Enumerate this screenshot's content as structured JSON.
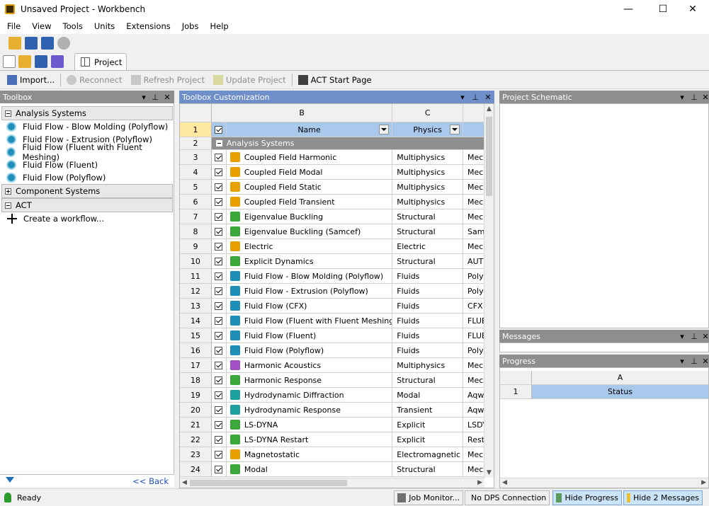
{
  "window": {
    "title": "Unsaved Project - Workbench",
    "min": "—",
    "max": "☐",
    "close": "✕"
  },
  "menu": [
    "File",
    "View",
    "Tools",
    "Units",
    "Extensions",
    "Jobs",
    "Help"
  ],
  "tab": {
    "label": "Project"
  },
  "toolbar": {
    "import": "Import...",
    "reconnect": "Reconnect",
    "refresh": "Refresh Project",
    "update": "Update Project",
    "act_start": "ACT Start Page"
  },
  "toolbox": {
    "title": "Toolbox",
    "groups": [
      {
        "label": "Analysis Systems",
        "items": [
          "Fluid Flow - Blow Molding (Polyflow)",
          "Fluid Flow - Extrusion (Polyflow)",
          "Fluid Flow (Fluent with Fluent Meshing)",
          "Fluid Flow (Fluent)",
          "Fluid Flow (Polyflow)"
        ]
      },
      {
        "label": "Component Systems"
      },
      {
        "label": "ACT",
        "items": [
          "Create a workflow..."
        ]
      }
    ],
    "back": "<< Back"
  },
  "customization": {
    "title": "Toolbox Customization",
    "col_letters": [
      "B",
      "C"
    ],
    "col_names": [
      "Name",
      "Physics"
    ],
    "group_row": {
      "num": "2",
      "label": "Analysis Systems"
    },
    "rows": [
      {
        "num": "3",
        "name": "Coupled Field Harmonic",
        "physics": "Multiphysics",
        "d": "Mech",
        "color": "#e8a000"
      },
      {
        "num": "4",
        "name": "Coupled Field Modal",
        "physics": "Multiphysics",
        "d": "Mech",
        "color": "#e8a000"
      },
      {
        "num": "5",
        "name": "Coupled Field Static",
        "physics": "Multiphysics",
        "d": "Mech",
        "color": "#e8a000"
      },
      {
        "num": "6",
        "name": "Coupled Field Transient",
        "physics": "Multiphysics",
        "d": "Mech",
        "color": "#e8a000"
      },
      {
        "num": "7",
        "name": "Eigenvalue Buckling",
        "physics": "Structural",
        "d": "Mech",
        "color": "#3aa83a"
      },
      {
        "num": "8",
        "name": "Eigenvalue Buckling (Samcef)",
        "physics": "Structural",
        "d": "Sam",
        "color": "#3aa83a"
      },
      {
        "num": "9",
        "name": "Electric",
        "physics": "Electric",
        "d": "Mech",
        "color": "#e8a000"
      },
      {
        "num": "10",
        "name": "Explicit Dynamics",
        "physics": "Structural",
        "d": "AUTO",
        "color": "#3aa83a"
      },
      {
        "num": "11",
        "name": "Fluid Flow - Blow Molding (Polyflow)",
        "physics": "Fluids",
        "d": "Poly",
        "color": "#1f8fb8"
      },
      {
        "num": "12",
        "name": "Fluid Flow - Extrusion (Polyflow)",
        "physics": "Fluids",
        "d": "Poly",
        "color": "#1f8fb8"
      },
      {
        "num": "13",
        "name": "Fluid Flow (CFX)",
        "physics": "Fluids",
        "d": "CFX",
        "color": "#1f8fb8"
      },
      {
        "num": "14",
        "name": "Fluid Flow (Fluent with Fluent Meshing)",
        "physics": "Fluids",
        "d": "FLUE",
        "color": "#1f8fb8"
      },
      {
        "num": "15",
        "name": "Fluid Flow (Fluent)",
        "physics": "Fluids",
        "d": "FLUE",
        "color": "#1f8fb8"
      },
      {
        "num": "16",
        "name": "Fluid Flow (Polyflow)",
        "physics": "Fluids",
        "d": "Poly",
        "color": "#1f8fb8"
      },
      {
        "num": "17",
        "name": "Harmonic Acoustics",
        "physics": "Multiphysics",
        "d": "Mech",
        "color": "#a050c0"
      },
      {
        "num": "18",
        "name": "Harmonic Response",
        "physics": "Structural",
        "d": "Mech",
        "color": "#3aa83a"
      },
      {
        "num": "19",
        "name": "Hydrodynamic Diffraction",
        "physics": "Modal",
        "d": "Aqw",
        "color": "#1fa0a0"
      },
      {
        "num": "20",
        "name": "Hydrodynamic Response",
        "physics": "Transient",
        "d": "Aqw",
        "color": "#1fa0a0"
      },
      {
        "num": "21",
        "name": "LS-DYNA",
        "physics": "Explicit",
        "d": "LSDY",
        "color": "#3aa83a"
      },
      {
        "num": "22",
        "name": "LS-DYNA Restart",
        "physics": "Explicit",
        "d": "Rest",
        "color": "#3aa83a"
      },
      {
        "num": "23",
        "name": "Magnetostatic",
        "physics": "Electromagnetic",
        "d": "Mech",
        "color": "#e8a000"
      },
      {
        "num": "24",
        "name": "Modal",
        "physics": "Structural",
        "d": "Mech",
        "color": "#3aa83a"
      }
    ]
  },
  "schematic": {
    "title": "Project Schematic"
  },
  "messages": {
    "title": "Messages"
  },
  "progress": {
    "title": "Progress",
    "col": "A",
    "row_num": "1",
    "status": "Status"
  },
  "status": {
    "ready": "Ready",
    "job_monitor": "Job Monitor...",
    "dps": "No DPS Connection",
    "hide_progress": "Hide Progress",
    "hide_messages": "Hide 2 Messages"
  },
  "colors": {
    "pane_gray": "#8e8e8e",
    "pane_blue": "#6e8fc7",
    "selected_header": "#a8c8ec"
  }
}
